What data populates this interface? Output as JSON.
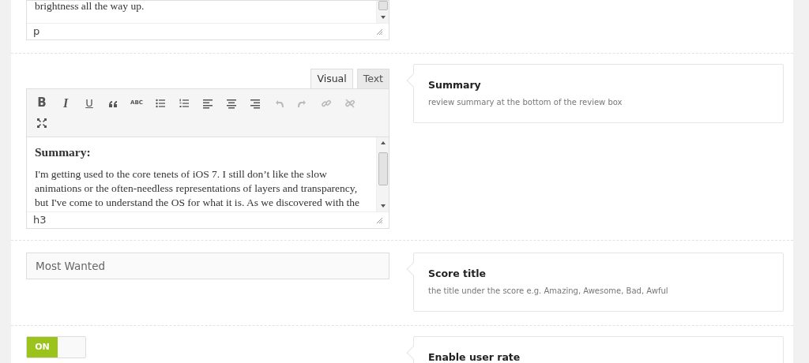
{
  "fields": [
    {
      "kind": "editor",
      "content": [
        {
          "kind": "paragraph",
          "text": "brightness all the way up."
        }
      ],
      "path": "p"
    },
    {
      "kind": "editor",
      "tabs": [
        {
          "label": "Visual",
          "selected": true
        },
        {
          "label": "Text",
          "selected": false
        }
      ],
      "toolbar": [
        {
          "kind": "bold",
          "label": "B",
          "disabled": false
        },
        {
          "kind": "italic",
          "label": "I",
          "disabled": false
        },
        {
          "kind": "underline",
          "label": "U",
          "disabled": false
        },
        {
          "kind": "quote",
          "disabled": false
        },
        {
          "kind": "strike",
          "label": "ABC",
          "disabled": false
        },
        {
          "kind": "bullets",
          "disabled": false
        },
        {
          "kind": "numbers",
          "disabled": false
        },
        {
          "kind": "align-left",
          "disabled": false
        },
        {
          "kind": "align-center",
          "disabled": false
        },
        {
          "kind": "align-right",
          "disabled": false
        },
        {
          "kind": "undo",
          "disabled": true
        },
        {
          "kind": "redo",
          "disabled": true
        },
        {
          "kind": "link",
          "disabled": true
        },
        {
          "kind": "unlink",
          "disabled": true
        },
        {
          "kind": "fullscreen",
          "disabled": false
        }
      ],
      "content": [
        {
          "kind": "heading",
          "text": "Summary:"
        },
        {
          "kind": "paragraph",
          "text": "I'm getting used to the core tenets of iOS 7. I still don’t like the slow animations or the often-needless representations of layers and transparency, but I've come to understand the OS for what it is. As we discovered with the"
        }
      ],
      "path": "h3",
      "help": {
        "title": "Summary",
        "description": "review summary at the bottom of the review box"
      }
    },
    {
      "kind": "text",
      "value": "Most Wanted",
      "help": {
        "title": "Score title",
        "description": "the title under the score e.g. Amazing, Awesome, Bad, Awful"
      }
    },
    {
      "kind": "toggle",
      "on": true,
      "label": "ON",
      "help": {
        "title": "Enable user rate"
      }
    }
  ]
}
